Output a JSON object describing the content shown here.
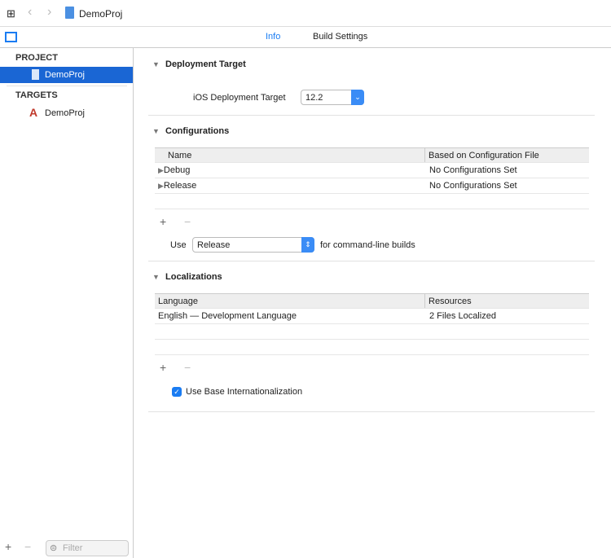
{
  "toolbar": {
    "title": "DemoProj"
  },
  "tabs": [
    {
      "label": "Info",
      "active": true
    },
    {
      "label": "Build Settings",
      "active": false
    }
  ],
  "sidebar": {
    "project_header": "PROJECT",
    "project_item": "DemoProj",
    "targets_header": "TARGETS",
    "target_item": "DemoProj",
    "filter_placeholder": "Filter"
  },
  "deployment": {
    "title": "Deployment Target",
    "label": "iOS Deployment Target",
    "value": "12.2"
  },
  "configurations": {
    "title": "Configurations",
    "columns": [
      "Name",
      "Based on Configuration File"
    ],
    "rows": [
      {
        "name": "Debug",
        "file": "No Configurations Set"
      },
      {
        "name": "Release",
        "file": "No Configurations Set"
      }
    ],
    "use_label": "Use",
    "use_value": "Release",
    "use_suffix": "for command-line builds"
  },
  "localizations": {
    "title": "Localizations",
    "columns": [
      "Language",
      "Resources"
    ],
    "rows": [
      {
        "language": "English — Development Language",
        "resources": "2 Files Localized"
      }
    ],
    "base_intl_label": "Use Base Internationalization",
    "base_intl_checked": true
  },
  "colors": {
    "accent": "#1a66d4"
  }
}
